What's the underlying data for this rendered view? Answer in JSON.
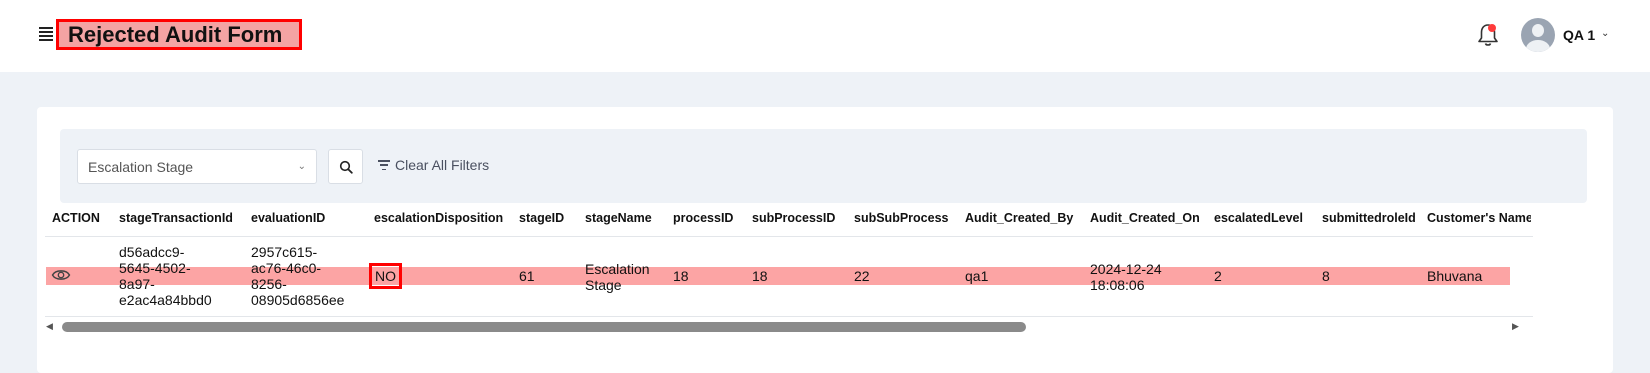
{
  "header": {
    "title": "Rejected Audit Form",
    "user_name": "QA 1"
  },
  "filters": {
    "stage_select": "Escalation Stage",
    "clear_label": "Clear All Filters"
  },
  "table": {
    "columns": [
      "ACTION",
      "stageTransactionId",
      "evaluationID",
      "escalationDisposition",
      "stageID",
      "stageName",
      "processID",
      "subProcessID",
      "subSubProcess",
      "Audit_Created_By",
      "Audit_Created_On",
      "escalatedLevel",
      "submittedroleId",
      "Customer's Name"
    ],
    "row": {
      "stageTransactionId": [
        "d56adcc9-",
        "5645-4502-",
        "8a97-",
        "e2ac4a84bbd0"
      ],
      "evaluationID": [
        "2957c615-",
        "ac76-46c0-",
        "8256-",
        "08905d6856ee"
      ],
      "escalationDisposition": "NO",
      "stageID": "61",
      "stageName": [
        "Escalation",
        "Stage"
      ],
      "processID": "18",
      "subProcessID": "18",
      "subSubProcess": "22",
      "Audit_Created_By": "qa1",
      "Audit_Created_On": [
        "2024-12-24",
        "18:08:06"
      ],
      "escalatedLevel": "2",
      "submittedroleId": "8",
      "customerName": "Bhuvana"
    }
  },
  "colors": {
    "highlight": "#fca4a4",
    "annotation_border": "#ff0000",
    "notification_dot": "#ff3b3b"
  },
  "icons": {
    "menu": "hamburger-menu-icon",
    "bell": "bell-icon",
    "search": "search-icon",
    "filter": "filter-icon",
    "view": "eye-icon"
  }
}
